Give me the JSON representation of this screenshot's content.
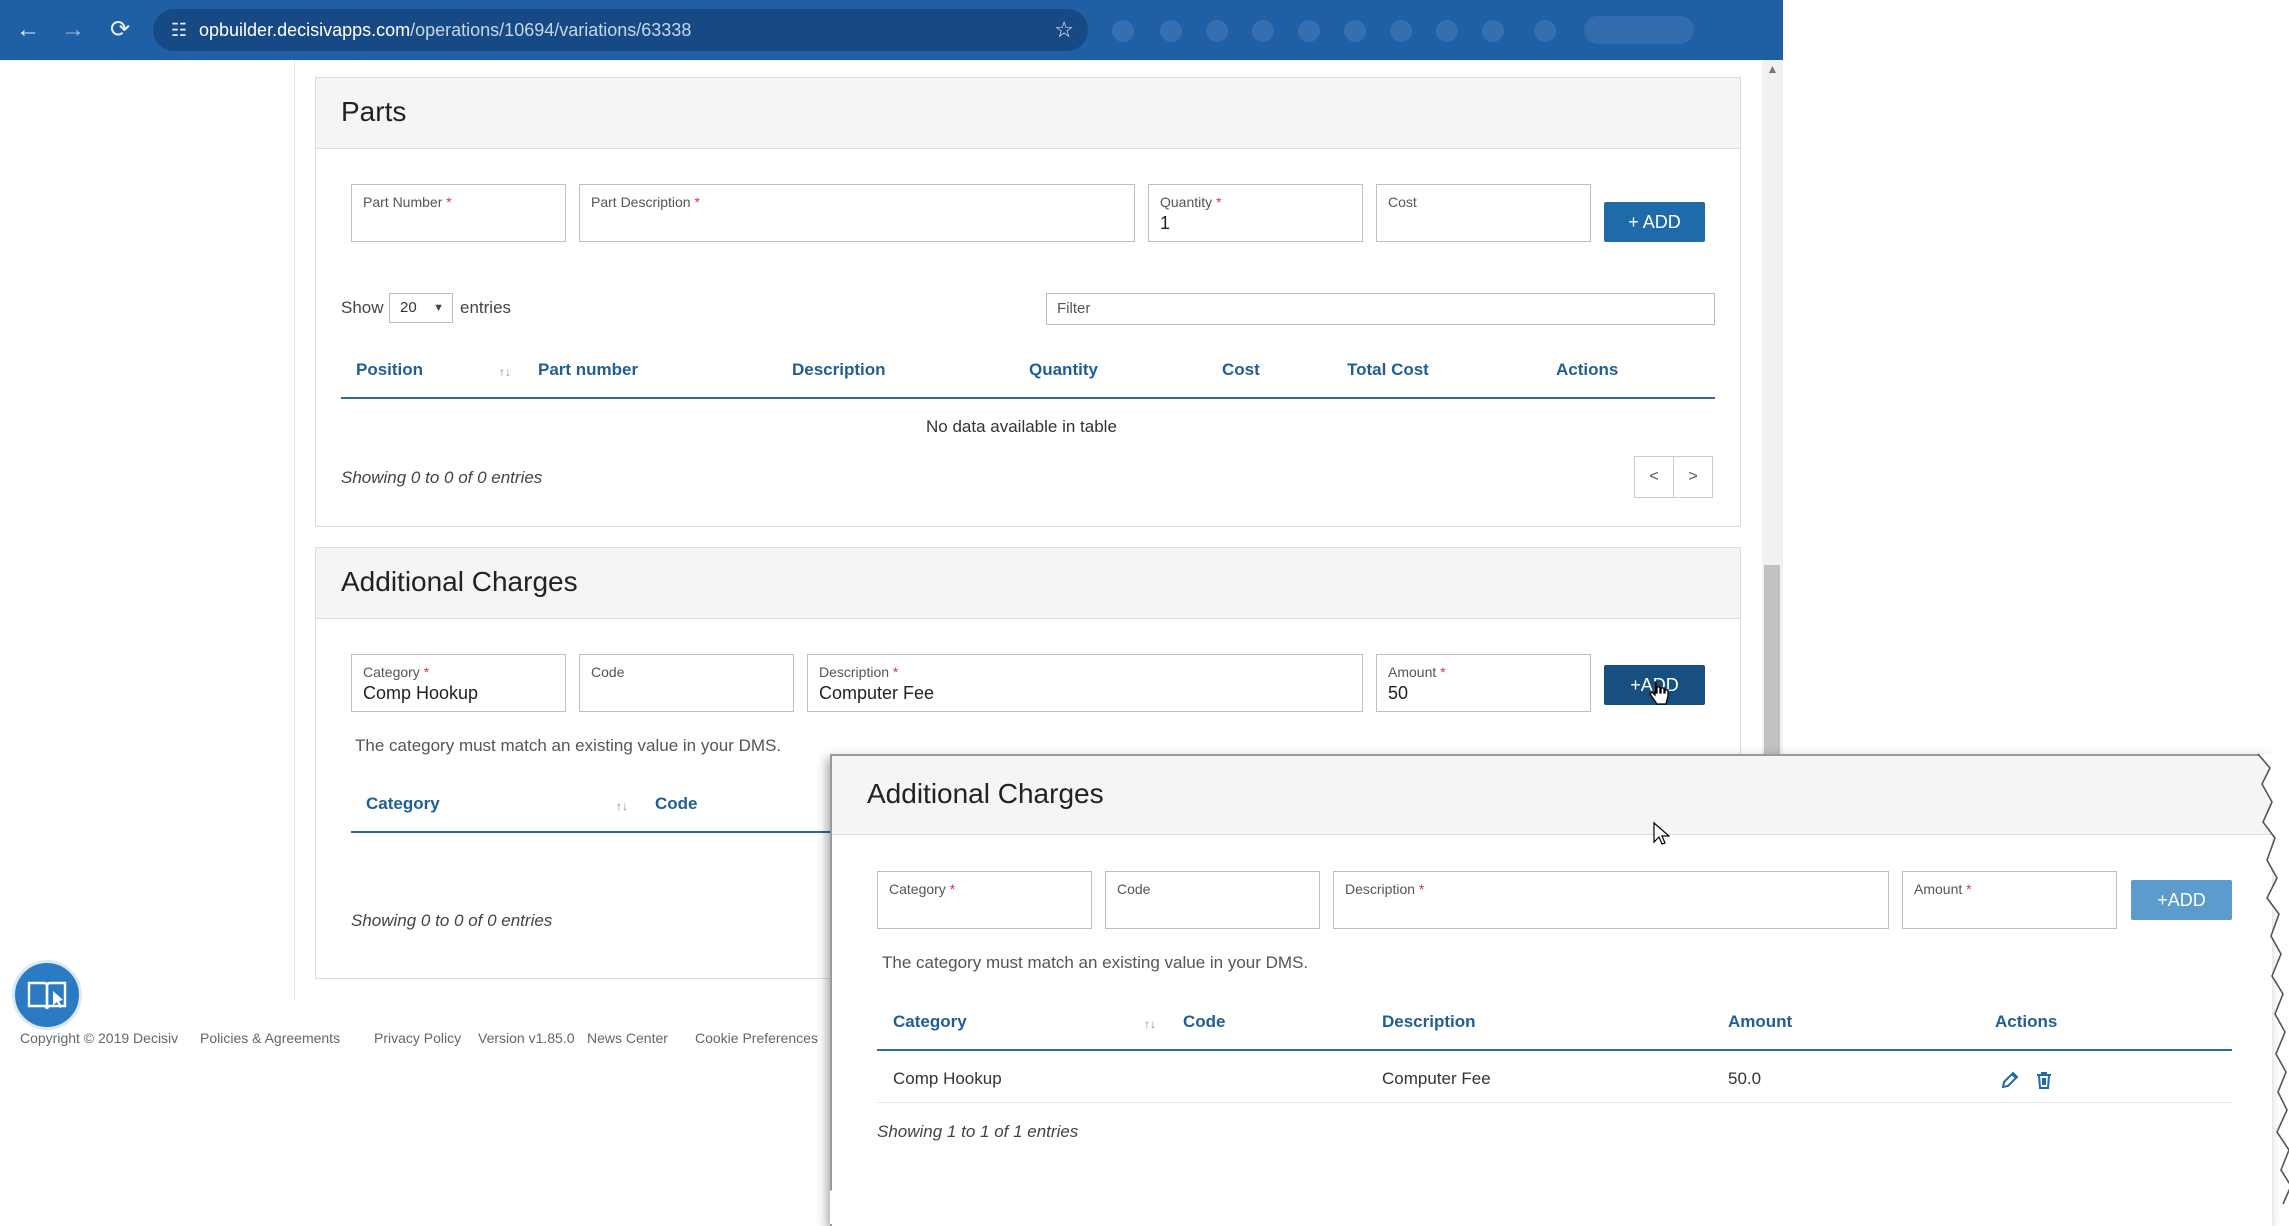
{
  "browser": {
    "url_host": "opbuilder.decisivapps.com",
    "url_path": "/operations/10694/variations/63338"
  },
  "parts": {
    "title": "Parts",
    "fields": {
      "part_number_label": "Part Number",
      "part_description_label": "Part Description",
      "quantity_label": "Quantity",
      "quantity_value": "1",
      "cost_label": "Cost",
      "required_mark": "*"
    },
    "add_label": "+ ADD",
    "show_label": "Show",
    "entries_value": "20",
    "entries_label": "entries",
    "filter_placeholder": "Filter",
    "columns": [
      "Position",
      "Part number",
      "Description",
      "Quantity",
      "Cost",
      "Total Cost",
      "Actions"
    ],
    "empty_text": "No data available in table",
    "info": "Showing 0 to 0 of 0 entries",
    "prev_label": "<",
    "next_label": ">"
  },
  "charges": {
    "title": "Additional Charges",
    "fields": {
      "category_label": "Category",
      "category_value": "Comp Hookup",
      "code_label": "Code",
      "description_label": "Description",
      "description_value": "Computer Fee",
      "amount_label": "Amount",
      "amount_value": "50"
    },
    "add_label": "+ADD",
    "note": "The category must match an existing value in your DMS.",
    "columns": [
      "Category",
      "Code"
    ],
    "info": "Showing 0 to 0 of 0 entries"
  },
  "footer": {
    "copyright": "Copyright © 2019 Decisiv",
    "links": [
      "Policies & Agreements",
      "Privacy Policy",
      "Version v1.85.0",
      "News Center",
      "Cookie Preferences"
    ]
  },
  "callout": {
    "title": "Additional Charges",
    "fields": {
      "category_label": "Category",
      "code_label": "Code",
      "description_label": "Description",
      "amount_label": "Amount"
    },
    "add_label": "+ADD",
    "note": "The category must match an existing value in your DMS.",
    "columns": [
      "Category",
      "Code",
      "Description",
      "Amount",
      "Actions"
    ],
    "rows": [
      {
        "category": "Comp Hookup",
        "code": "",
        "description": "Computer Fee",
        "amount": "50.0"
      }
    ],
    "info": "Showing 1 to 1 of 1 entries"
  },
  "colors": {
    "browser_bar": "#1f5fa6",
    "accent": "#1f6aa8",
    "header_text": "#1f5f96",
    "required": "#d23a3a"
  }
}
